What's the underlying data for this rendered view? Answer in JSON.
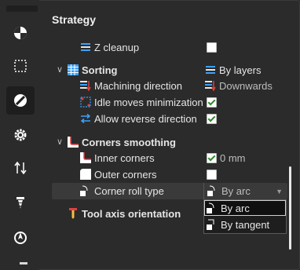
{
  "panel": {
    "title": "Strategy"
  },
  "rail": {
    "icons": [
      "pie-chart-icon",
      "dashed-square-icon",
      "no-entry-icon",
      "gear-icon",
      "vertical-arrows-icon",
      "drill-bit-icon",
      "tool-tip-icon"
    ]
  },
  "rows": {
    "z_cleanup": {
      "label": "Z cleanup",
      "checked": false
    },
    "sorting": {
      "label": "Sorting",
      "value": "By layers"
    },
    "machining_direction": {
      "label": "Machining direction",
      "value": "Downwards"
    },
    "idle_moves": {
      "label": "Idle moves minimization",
      "checked": true
    },
    "allow_reverse": {
      "label": "Allow reverse direction",
      "checked": true
    },
    "corners_smoothing": {
      "label": "Corners smoothing"
    },
    "inner_corners": {
      "label": "Inner corners",
      "checked": true,
      "value": "0 mm"
    },
    "outer_corners": {
      "label": "Outer corners",
      "checked": false
    },
    "corner_roll_type": {
      "label": "Corner roll type",
      "value": "By arc"
    },
    "tool_axis_orientation": {
      "label": "Tool axis orientation"
    }
  },
  "dropdown": {
    "options": [
      "By arc",
      "By tangent"
    ],
    "selected": "By arc"
  },
  "colors": {
    "background": "#2b2b2b",
    "accent_blue": "#3aa0ff",
    "accent_red": "#e04040",
    "check_green": "#2e8b2e"
  }
}
